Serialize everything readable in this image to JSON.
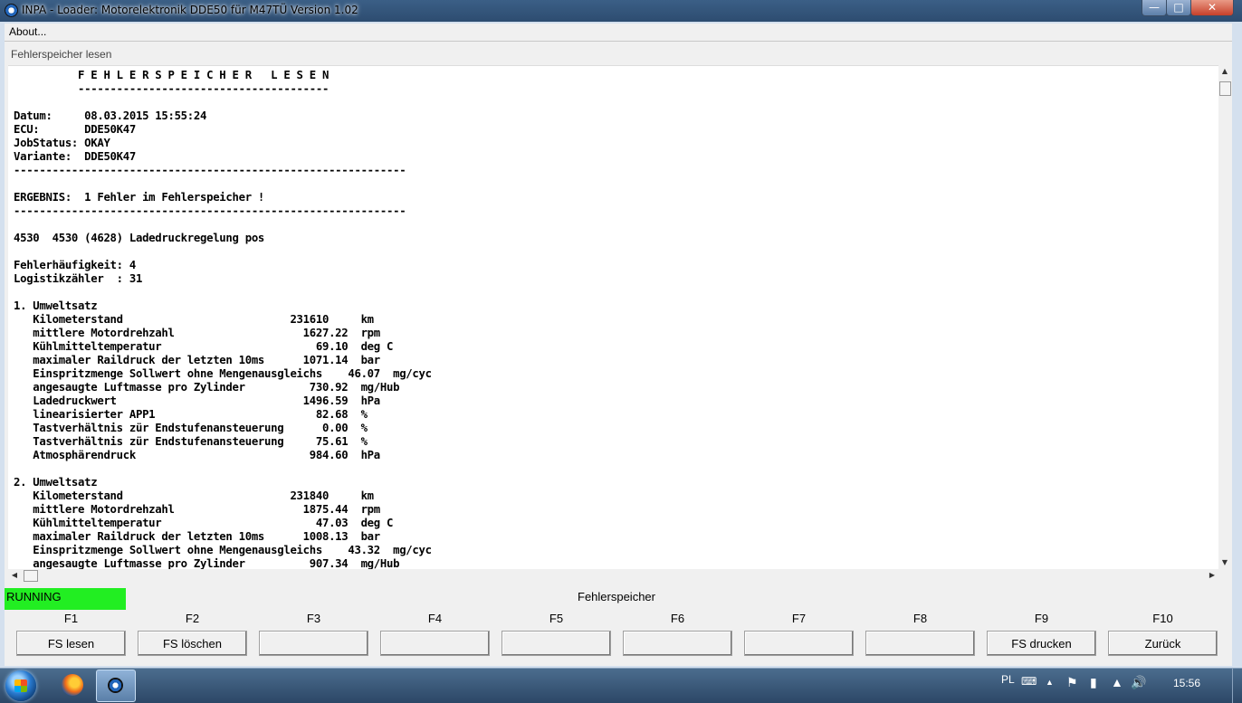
{
  "window": {
    "title": "INPA - Loader:  Motorelektronik DDE50 für M47TÜ Version 1.02",
    "min_icon": "minimize-icon",
    "max_icon": "maximize-icon",
    "close_icon": "close-icon"
  },
  "menu": {
    "about": "About..."
  },
  "panel": {
    "title": "Fehlerspeicher lesen",
    "content": "          F E H L E R S P E I C H E R   L E S E N\n          ---------------------------------------\n\nDatum:     08.03.2015 15:55:24\nECU:       DDE50K47\nJobStatus: OKAY\nVariante:  DDE50K47\n-------------------------------------------------------------\n\nERGEBNIS:  1 Fehler im Fehlerspeicher !\n-------------------------------------------------------------\n\n4530  4530 (4628) Ladedruckregelung pos\n\nFehlerhäufigkeit: 4\nLogistikzähler  : 31\n\n1. Umweltsatz\n   Kilometerstand                          231610     km\n   mittlere Motordrehzahl                    1627.22  rpm\n   Kühlmitteltemperatur                        69.10  deg C\n   maximaler Raildruck der letzten 10ms      1071.14  bar\n   Einspritzmenge Sollwert ohne Mengenausgleichs    46.07  mg/cyc\n   angesaugte Luftmasse pro Zylinder          730.92  mg/Hub\n   Ladedruckwert                             1496.59  hPa\n   linearisierter APP1                         82.68  %\n   Tastverhältnis zür Endstufenansteuerung      0.00  %\n   Tastverhältnis zür Endstufenansteuerung     75.61  %\n   Atmosphärendruck                           984.60  hPa\n\n2. Umweltsatz\n   Kilometerstand                          231840     km\n   mittlere Motordrehzahl                    1875.44  rpm\n   Kühlmitteltemperatur                        47.03  deg C\n   maximaler Raildruck der letzten 10ms      1008.13  bar\n   Einspritzmenge Sollwert ohne Mengenausgleichs    43.32  mg/cyc\n   angesaugte Luftmasse pro Zylinder          907.34  mg/Hub"
  },
  "status": {
    "state": "RUNNING",
    "state_color": "#22ee22",
    "title": "Fehlerspeicher"
  },
  "fkeys": [
    {
      "key": "F1",
      "label": "FS lesen"
    },
    {
      "key": "F2",
      "label": "FS löschen"
    },
    {
      "key": "F3",
      "label": ""
    },
    {
      "key": "F4",
      "label": ""
    },
    {
      "key": "F5",
      "label": ""
    },
    {
      "key": "F6",
      "label": ""
    },
    {
      "key": "F7",
      "label": ""
    },
    {
      "key": "F8",
      "label": ""
    },
    {
      "key": "F9",
      "label": "FS drucken"
    },
    {
      "key": "F10",
      "label": "Zurück"
    }
  ],
  "taskbar": {
    "language": "PL",
    "clock": "15:56"
  }
}
